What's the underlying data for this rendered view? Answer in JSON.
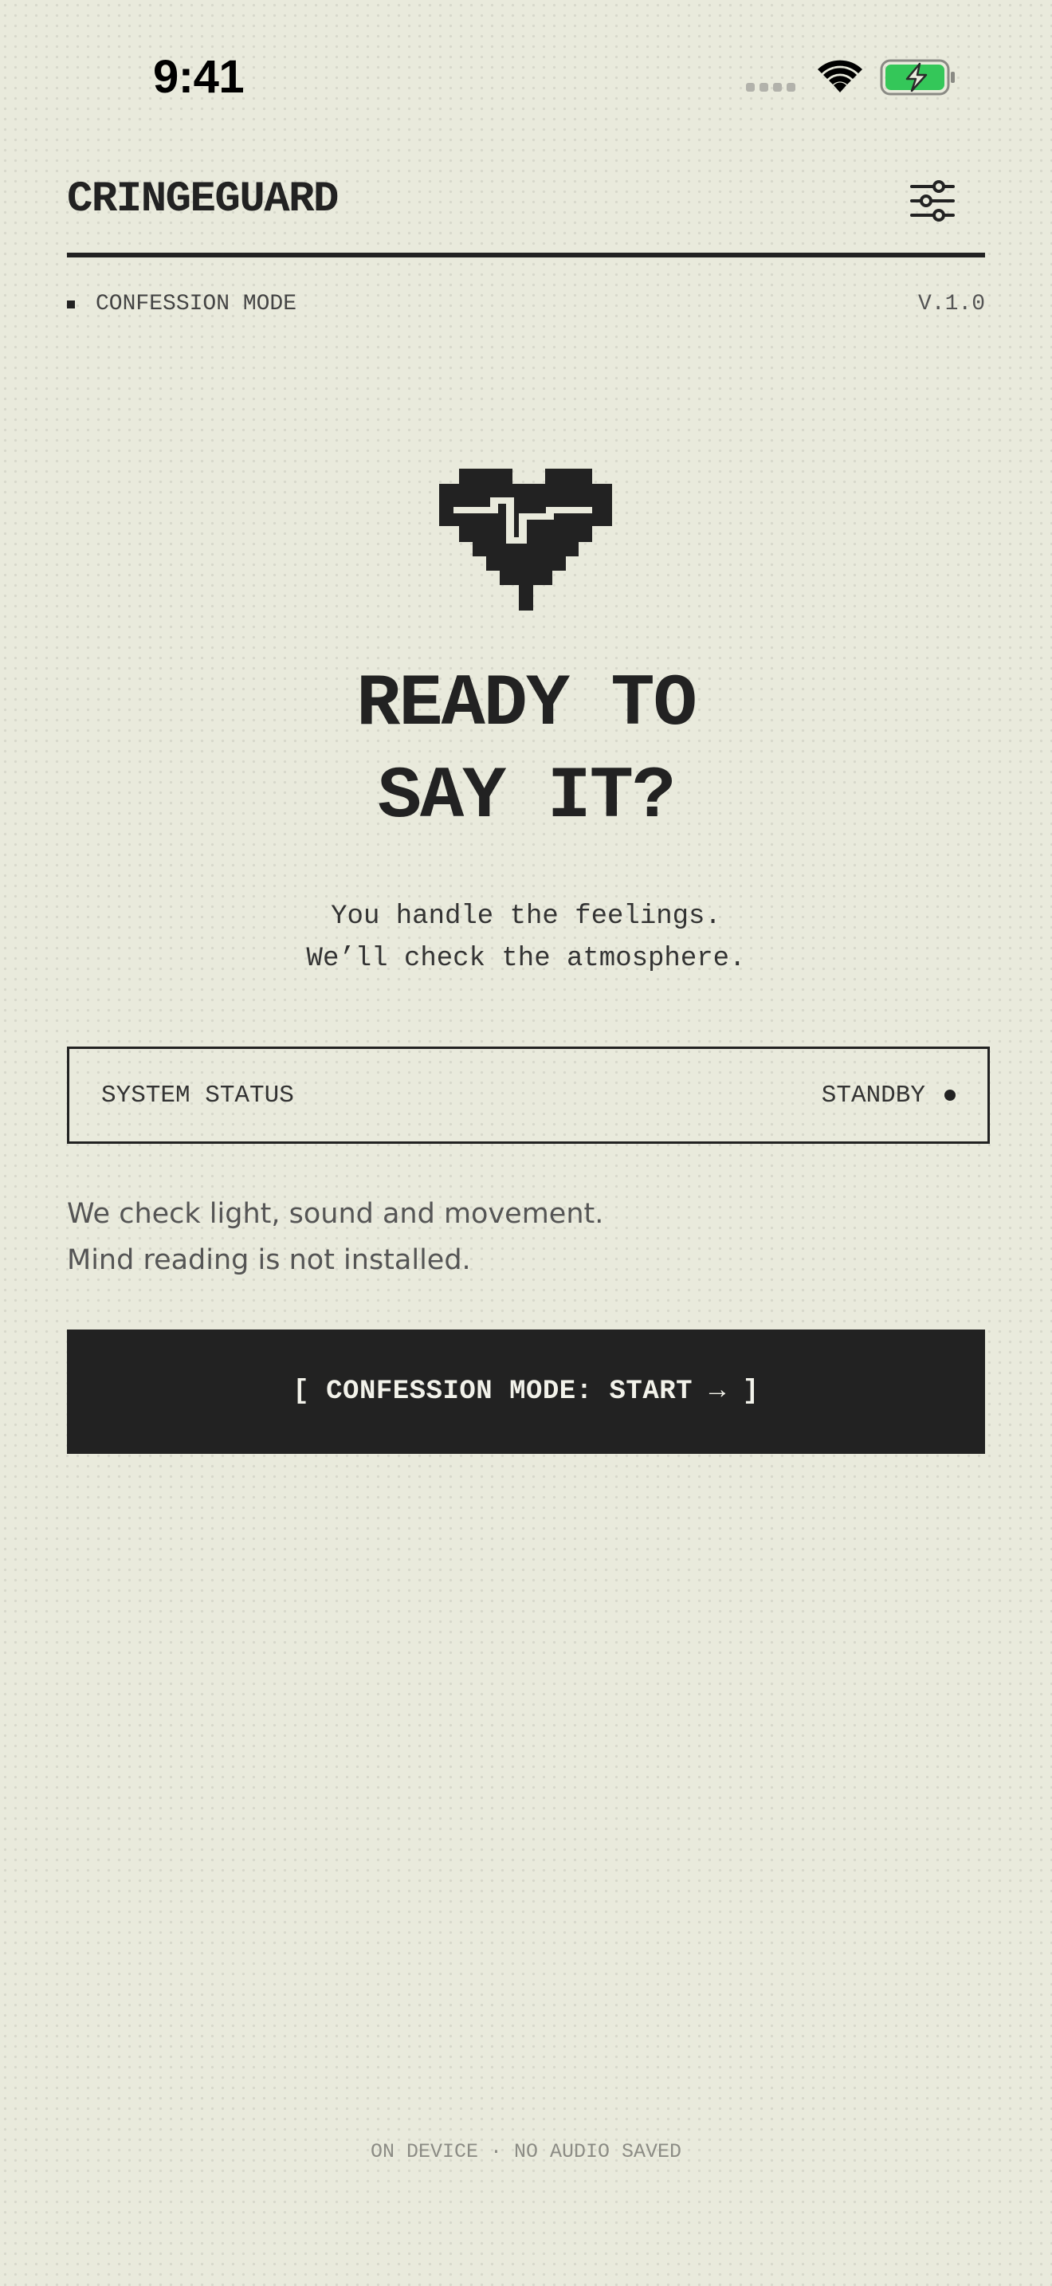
{
  "status_bar": {
    "time": "9:41"
  },
  "header": {
    "brand": "CRINGEGUARD",
    "settings_icon": "sliders-icon",
    "mode": "CONFESSION MODE",
    "version": "V.1.0"
  },
  "hero": {
    "icon": "pixel-heart-pulse-icon",
    "headline_line1": "READY TO",
    "headline_line2": "SAY IT?",
    "subtitle_line1": "You handle the feelings.",
    "subtitle_line2": "We’ll check the atmosphere."
  },
  "status_box": {
    "label": "SYSTEM STATUS",
    "value": "STANDBY"
  },
  "description": {
    "line1": "We check light, sound and movement.",
    "line2": "Mind reading is not installed."
  },
  "cta": {
    "label": "[ CONFESSION MODE: START → ]"
  },
  "footer": {
    "text": "ON DEVICE · NO AUDIO SAVED"
  },
  "colors": {
    "background": "#e9eadc",
    "ink": "#222222",
    "battery_fill": "#34c759"
  }
}
